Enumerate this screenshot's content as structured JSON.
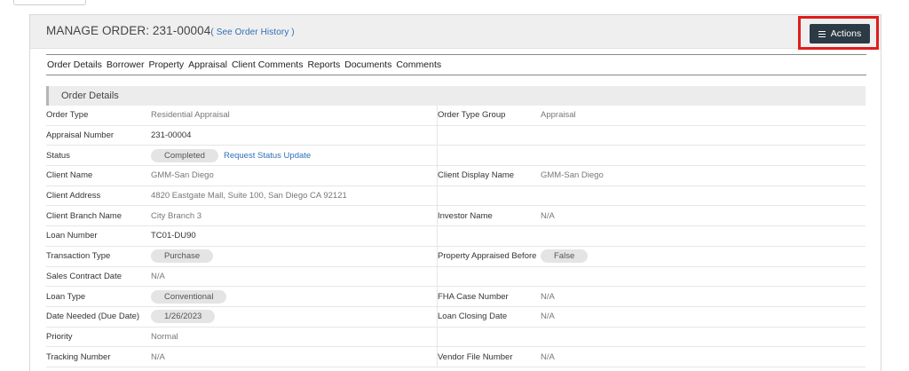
{
  "header": {
    "title_prefix": "MANAGE ORDER: ",
    "order_number": "231-00004",
    "history_link": "( See Order History )",
    "actions_label": "Actions"
  },
  "tabs": [
    {
      "label": "Order Details"
    },
    {
      "label": "Borrower"
    },
    {
      "label": "Property"
    },
    {
      "label": "Appraisal"
    },
    {
      "label": "Client Comments"
    },
    {
      "label": "Reports"
    },
    {
      "label": "Documents"
    },
    {
      "label": "Comments"
    }
  ],
  "section": {
    "title": "Order Details",
    "rows": [
      {
        "label": "Order Type",
        "value": "Residential Appraisal",
        "label2": "Order Type Group",
        "value2": "Appraisal"
      },
      {
        "label": "Appraisal Number",
        "value": "231-00004",
        "label2": "",
        "value2": ""
      },
      {
        "label": "Status",
        "value": "Completed",
        "link": "Request Status Update",
        "label2": "",
        "value2": ""
      },
      {
        "label": "Client Name",
        "value": "GMM-San Diego",
        "label2": "Client Display Name",
        "value2": "GMM-San Diego"
      },
      {
        "label": "Client Address",
        "value": "4820 Eastgate Mall, Suite 100, San Diego CA 92121",
        "label2": "",
        "value2": ""
      },
      {
        "label": "Client Branch Name",
        "value": "City Branch 3",
        "label2": "Investor Name",
        "value2": "N/A"
      },
      {
        "label": "Loan Number",
        "value": "TC01-DU90",
        "label2": "",
        "value2": ""
      },
      {
        "label": "Transaction Type",
        "value": "Purchase",
        "label2": "Property Appraised Before",
        "value2": "False"
      },
      {
        "label": "Sales Contract Date",
        "value": "N/A",
        "label2": "",
        "value2": ""
      },
      {
        "label": "Loan Type",
        "value": "Conventional",
        "label2": "FHA Case Number",
        "value2": "N/A"
      },
      {
        "label": "Date Needed (Due Date)",
        "value": "1/26/2023",
        "label2": "Loan Closing Date",
        "value2": "N/A"
      },
      {
        "label": "Priority",
        "value": "Normal",
        "label2": "",
        "value2": ""
      },
      {
        "label": "Tracking Number",
        "value": "N/A",
        "label2": "Vendor File Number",
        "value2": "N/A"
      }
    ]
  }
}
